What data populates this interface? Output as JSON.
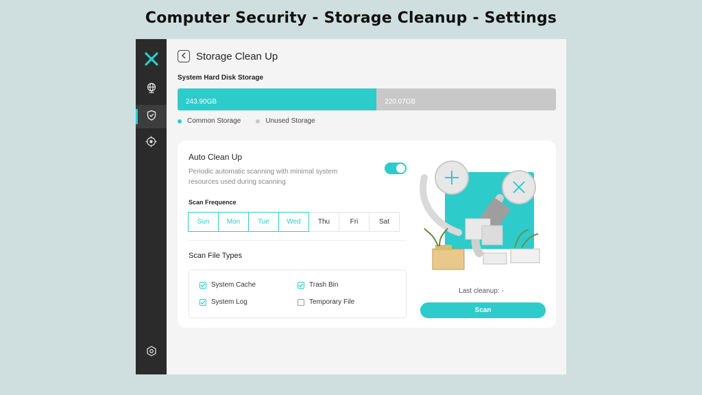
{
  "page_heading": "Computer Security - Storage Cleanup - Settings",
  "colors": {
    "accent": "#2ecbcb",
    "sidebar": "#2b2b2b",
    "unused": "#c8c8c8"
  },
  "sidebar": {
    "logo_icon": "x-logo-icon",
    "items": [
      {
        "icon": "globe-icon",
        "active": false
      },
      {
        "icon": "shield-icon",
        "active": true
      },
      {
        "icon": "crosshair-icon",
        "active": false
      }
    ],
    "bottom_icon": "hexagon-settings-icon"
  },
  "header": {
    "title": "Storage Clean Up",
    "back_icon": "back-icon"
  },
  "storage": {
    "label": "System Hard Disk Storage",
    "used_label": "243.90GB",
    "free_label": "220.07GB",
    "used_fraction": 0.5257,
    "legend_used": "Common Storage",
    "legend_free": "Unused Storage"
  },
  "auto_cleanup": {
    "title": "Auto Clean Up",
    "description": "Periodic automatic scanning with minimal system resources used during scanning",
    "enabled": true
  },
  "scan_frequency": {
    "label": "Scan Frequence",
    "days": [
      {
        "label": "Sun",
        "selected": true
      },
      {
        "label": "Mon",
        "selected": true
      },
      {
        "label": "Tue",
        "selected": true
      },
      {
        "label": "Wed",
        "selected": true
      },
      {
        "label": "Thu",
        "selected": false
      },
      {
        "label": "Fri",
        "selected": false
      },
      {
        "label": "Sat",
        "selected": false
      }
    ]
  },
  "file_types": {
    "title": "Scan File Types",
    "items": [
      {
        "label": "System Cache",
        "checked": true
      },
      {
        "label": "Trash Bin",
        "checked": true
      },
      {
        "label": "System Log",
        "checked": true
      },
      {
        "label": "Temporary File",
        "checked": false
      }
    ]
  },
  "cleanup": {
    "last_cleanup": "Last cleanup: -",
    "scan_label": "Scan"
  }
}
